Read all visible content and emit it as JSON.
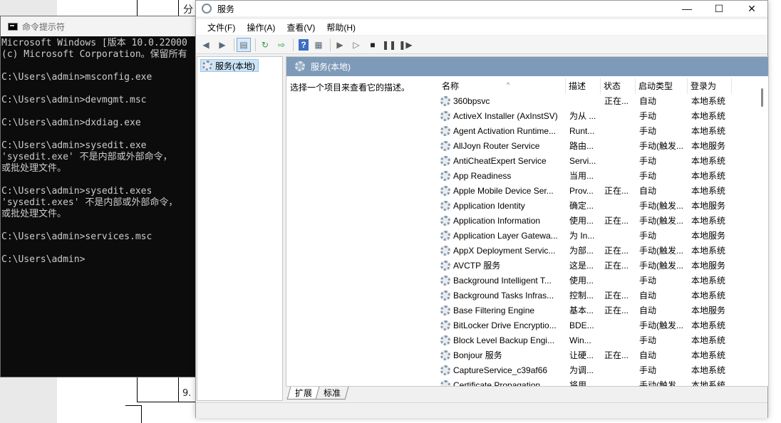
{
  "background_doc": {
    "top_text": "分类",
    "bottom_text": "9."
  },
  "cmd": {
    "title": "命令提示符",
    "lines": [
      "Microsoft Windows [版本 10.0.22000",
      "(c) Microsoft Corporation。保留所有",
      "",
      "C:\\Users\\admin>msconfig.exe",
      "",
      "C:\\Users\\admin>devmgmt.msc",
      "",
      "C:\\Users\\admin>dxdiag.exe",
      "",
      "C:\\Users\\admin>sysedit.exe",
      "'sysedit.exe' 不是内部或外部命令，",
      "或批处理文件。",
      "",
      "C:\\Users\\admin>sysedit.exes",
      "'sysedit.exes' 不是内部或外部命令，",
      "或批处理文件。",
      "",
      "C:\\Users\\admin>services.msc",
      "",
      "C:\\Users\\admin>"
    ]
  },
  "services": {
    "title": "服务",
    "menu": [
      "文件(F)",
      "操作(A)",
      "查看(V)",
      "帮助(H)"
    ],
    "window_controls": {
      "minimize": "—",
      "maximize": "☐",
      "close": "✕"
    },
    "toolbar_icons": [
      "back-icon",
      "forward-icon",
      "console-tree-icon",
      "refresh-icon",
      "export-icon",
      "help-icon",
      "properties-icon",
      "start-icon",
      "start-alt-icon",
      "stop-icon",
      "pause-icon",
      "restart-icon"
    ],
    "tree_item": "服务(本地)",
    "header_title": "服务(本地)",
    "description_hint": "选择一个项目来查看它的描述。",
    "columns": [
      "名称",
      "描述",
      "状态",
      "启动类型",
      "登录为"
    ],
    "rows": [
      {
        "name": "360bpsvc",
        "desc": "",
        "status": "正在...",
        "startup": "自动",
        "logon": "本地系统"
      },
      {
        "name": "ActiveX Installer (AxInstSV)",
        "desc": "为从 ...",
        "status": "",
        "startup": "手动",
        "logon": "本地系统"
      },
      {
        "name": "Agent Activation Runtime...",
        "desc": "Runt...",
        "status": "",
        "startup": "手动",
        "logon": "本地系统"
      },
      {
        "name": "AllJoyn Router Service",
        "desc": "路由...",
        "status": "",
        "startup": "手动(触发...",
        "logon": "本地服务"
      },
      {
        "name": "AntiCheatExpert Service",
        "desc": "Servi...",
        "status": "",
        "startup": "手动",
        "logon": "本地系统"
      },
      {
        "name": "App Readiness",
        "desc": "当用...",
        "status": "",
        "startup": "手动",
        "logon": "本地系统"
      },
      {
        "name": "Apple Mobile Device Ser...",
        "desc": "Prov...",
        "status": "正在...",
        "startup": "自动",
        "logon": "本地系统"
      },
      {
        "name": "Application Identity",
        "desc": "确定...",
        "status": "",
        "startup": "手动(触发...",
        "logon": "本地服务"
      },
      {
        "name": "Application Information",
        "desc": "使用...",
        "status": "正在...",
        "startup": "手动(触发...",
        "logon": "本地系统"
      },
      {
        "name": "Application Layer Gatewa...",
        "desc": "为 In...",
        "status": "",
        "startup": "手动",
        "logon": "本地服务"
      },
      {
        "name": "AppX Deployment Servic...",
        "desc": "为部...",
        "status": "正在...",
        "startup": "手动(触发...",
        "logon": "本地系统"
      },
      {
        "name": "AVCTP 服务",
        "desc": "这是...",
        "status": "正在...",
        "startup": "手动(触发...",
        "logon": "本地服务"
      },
      {
        "name": "Background Intelligent T...",
        "desc": "使用...",
        "status": "",
        "startup": "手动",
        "logon": "本地系统"
      },
      {
        "name": "Background Tasks Infras...",
        "desc": "控制...",
        "status": "正在...",
        "startup": "自动",
        "logon": "本地系统"
      },
      {
        "name": "Base Filtering Engine",
        "desc": "基本...",
        "status": "正在...",
        "startup": "自动",
        "logon": "本地服务"
      },
      {
        "name": "BitLocker Drive Encryptio...",
        "desc": "BDE...",
        "status": "",
        "startup": "手动(触发...",
        "logon": "本地系统"
      },
      {
        "name": "Block Level Backup Engi...",
        "desc": "Win...",
        "status": "",
        "startup": "手动",
        "logon": "本地系统"
      },
      {
        "name": "Bonjour 服务",
        "desc": "让硬...",
        "status": "正在...",
        "startup": "自动",
        "logon": "本地系统"
      },
      {
        "name": "CaptureService_c39af66",
        "desc": "为调...",
        "status": "",
        "startup": "手动",
        "logon": "本地系统"
      },
      {
        "name": "Certificate Propagation",
        "desc": "将用...",
        "status": "",
        "startup": "手动(触发...",
        "logon": "本地系统"
      }
    ],
    "tabs": [
      "扩展",
      "标准"
    ]
  }
}
